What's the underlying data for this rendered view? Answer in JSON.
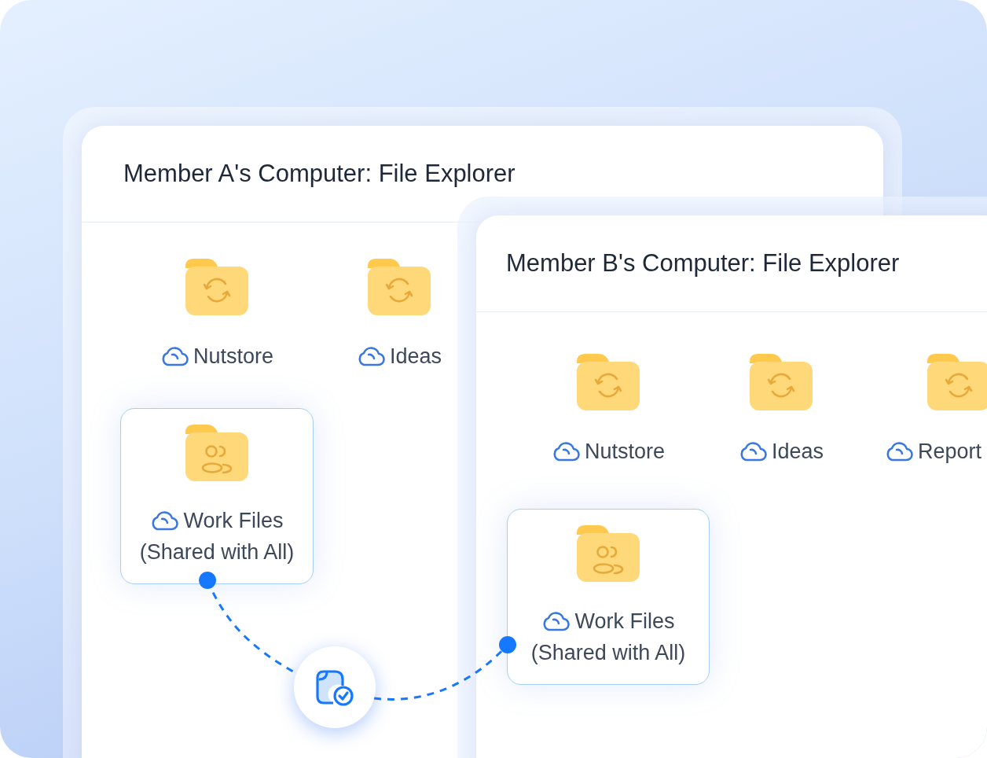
{
  "windows": [
    {
      "title": "Member A's Computer: File Explorer",
      "folders": [
        {
          "kind": "sync",
          "name": "Nutstore",
          "selected": false
        },
        {
          "kind": "sync",
          "name": "Ideas",
          "selected": false
        },
        {
          "kind": "shared",
          "name": "Work Files",
          "note": "(Shared with All)",
          "selected": true
        }
      ]
    },
    {
      "title": "Member B's Computer: File Explorer",
      "folders": [
        {
          "kind": "sync",
          "name": "Nutstore",
          "selected": false
        },
        {
          "kind": "sync",
          "name": "Ideas",
          "selected": false
        },
        {
          "kind": "sync",
          "name": "Report",
          "selected": false
        },
        {
          "kind": "shared",
          "name": "Work Files",
          "note": "(Shared with All)",
          "selected": true
        }
      ]
    }
  ]
}
